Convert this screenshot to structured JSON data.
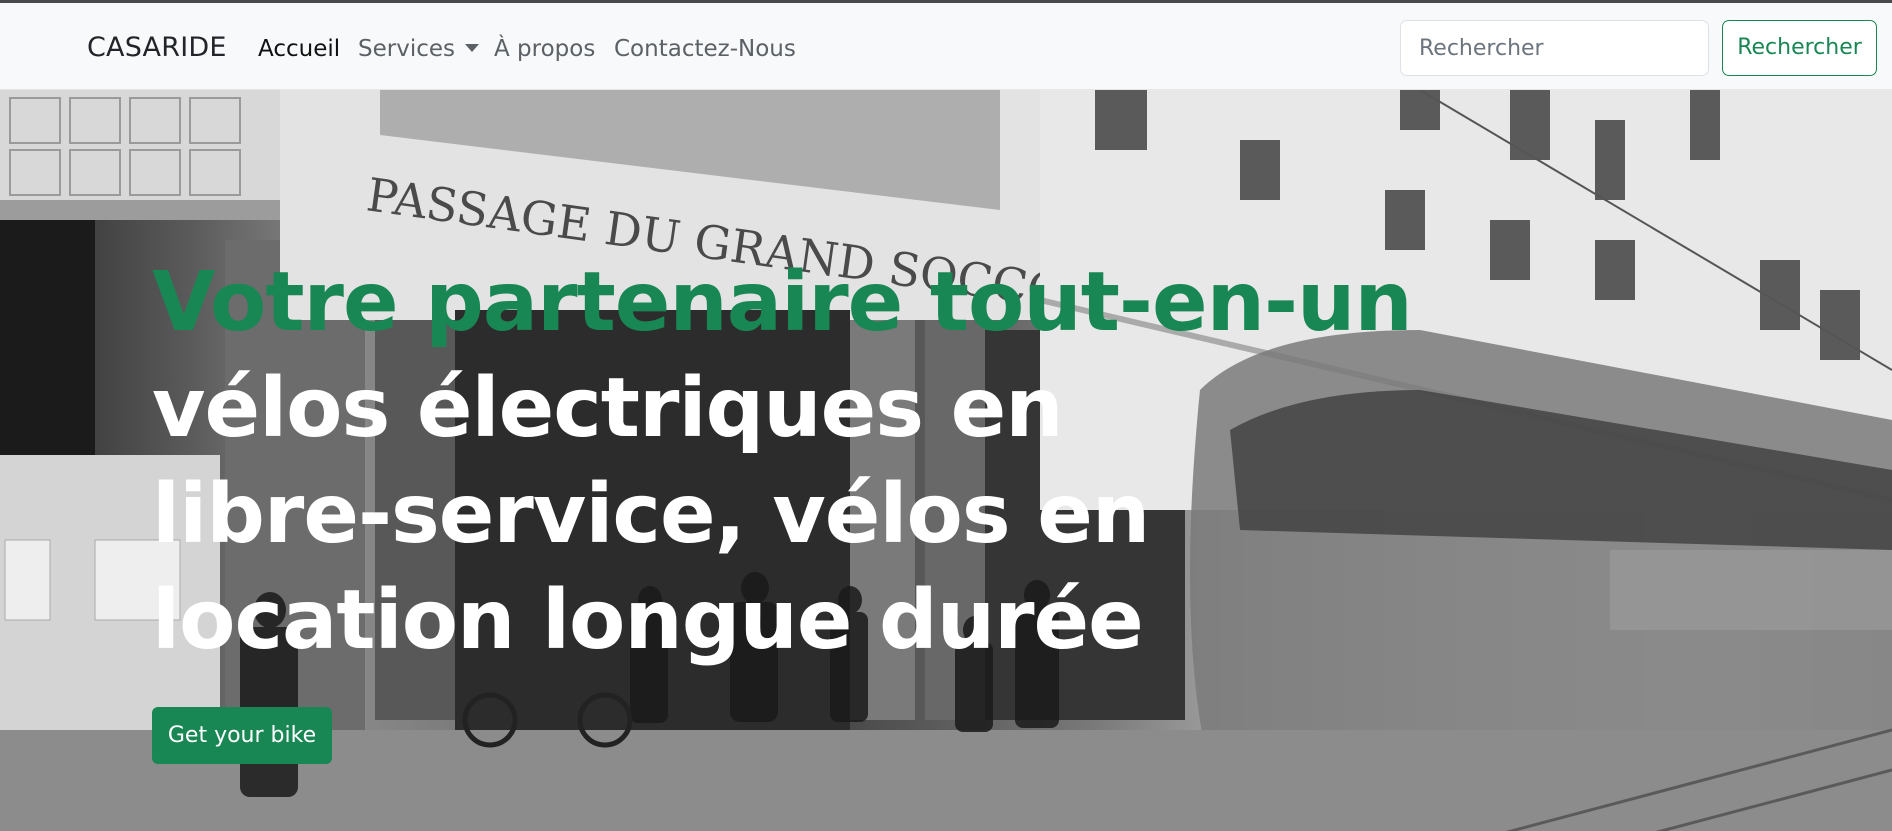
{
  "navbar": {
    "brand": "CASARIDE",
    "links": [
      {
        "label": "Accueil",
        "active": true
      },
      {
        "label": "Services",
        "dropdown": true
      },
      {
        "label": "À propos"
      },
      {
        "label": "Contactez-Nous"
      }
    ],
    "search": {
      "placeholder": "Rechercher",
      "button_label": "Rechercher"
    }
  },
  "hero": {
    "headline_green": "Votre partenaire tout-en-un",
    "headline_white": "vélos électriques en libre-service, vélos en location longue durée",
    "cta_label": "Get your bike",
    "background_sign_text": "PASSAGE DU GRAND SOCCO"
  },
  "colors": {
    "accent": "#198754",
    "navbar_bg": "#f8f9fa",
    "headline_white": "#ffffff"
  }
}
